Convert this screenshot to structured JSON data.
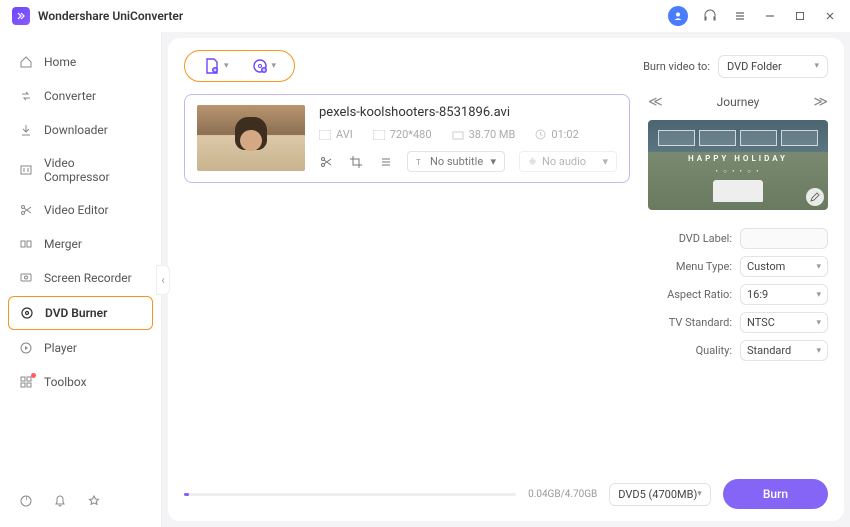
{
  "app_title": "Wondershare UniConverter",
  "titlebar": {
    "min": "−",
    "max": "□",
    "close": "✕"
  },
  "sidebar": {
    "items": [
      {
        "label": "Home"
      },
      {
        "label": "Converter"
      },
      {
        "label": "Downloader"
      },
      {
        "label": "Video Compressor"
      },
      {
        "label": "Video Editor"
      },
      {
        "label": "Merger"
      },
      {
        "label": "Screen Recorder"
      },
      {
        "label": "DVD Burner"
      },
      {
        "label": "Player"
      },
      {
        "label": "Toolbox"
      }
    ]
  },
  "top": {
    "burn_video_to": "Burn video to:",
    "burn_target": "DVD Folder"
  },
  "file": {
    "name": "pexels-koolshooters-8531896.avi",
    "format": "AVI",
    "resolution": "720*480",
    "size": "38.70 MB",
    "duration": "01:02",
    "subtitle": "No subtitle",
    "audio": "No audio"
  },
  "theme": {
    "title": "Journey",
    "overlay": "HAPPY HOLIDAY"
  },
  "form": {
    "dvd_label_label": "DVD Label:",
    "dvd_label_value": "",
    "menu_type_label": "Menu Type:",
    "menu_type": "Custom",
    "aspect_label": "Aspect Ratio:",
    "aspect": "16:9",
    "tv_label": "TV Standard:",
    "tv": "NTSC",
    "quality_label": "Quality:",
    "quality": "Standard"
  },
  "bottom": {
    "size": "0.04GB/4.70GB",
    "disc": "DVD5 (4700MB)",
    "burn": "Burn"
  }
}
